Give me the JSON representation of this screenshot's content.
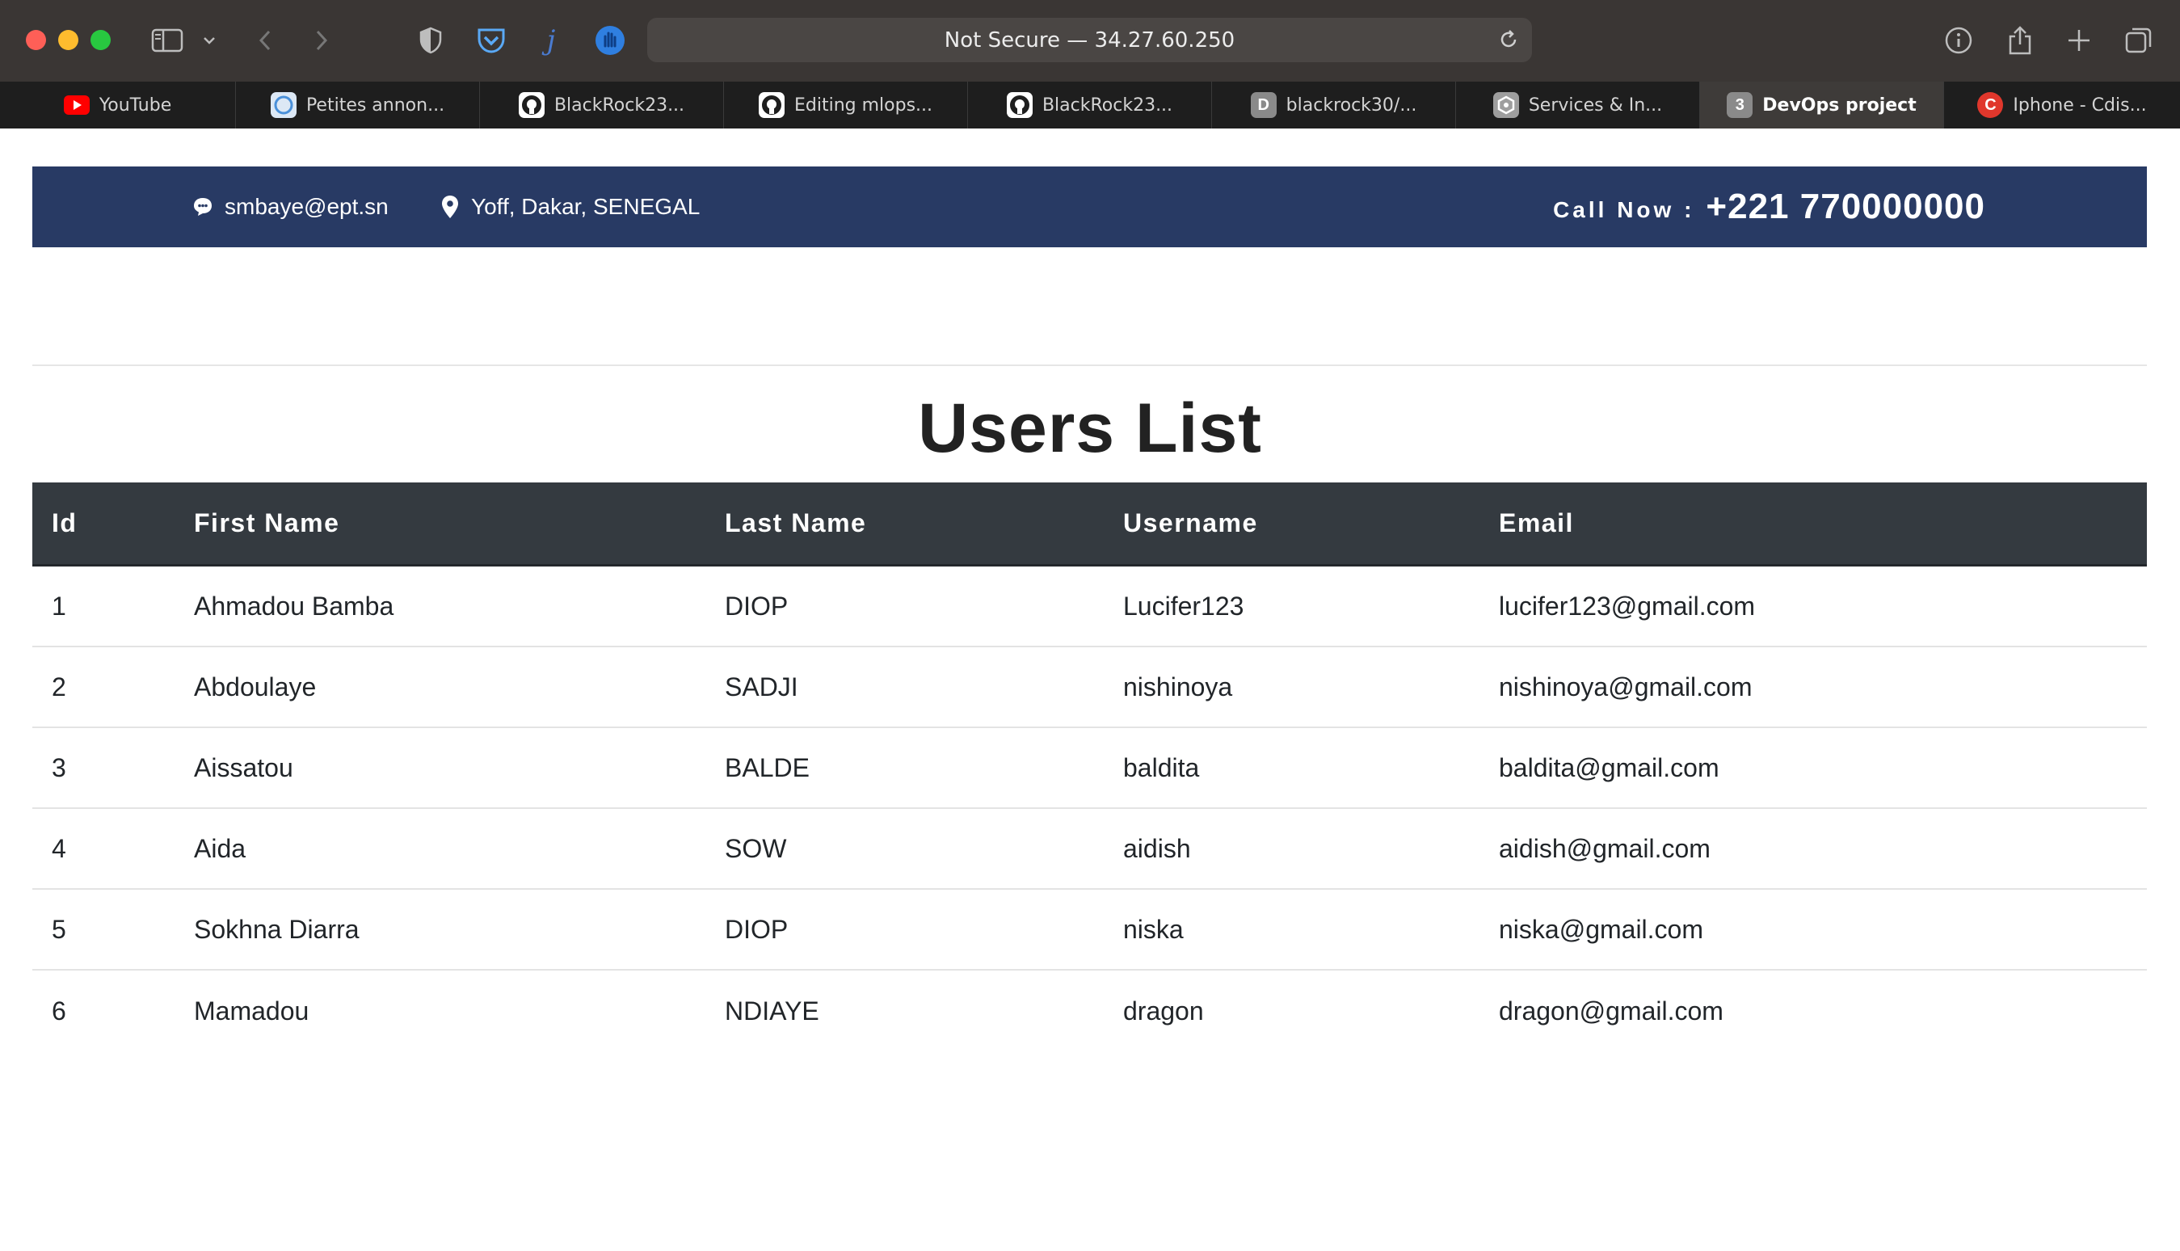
{
  "browser": {
    "address_text": "Not Secure — 34.27.60.250",
    "tabs": [
      {
        "label": "YouTube",
        "favicon": "youtube-icon",
        "color": "#ff0000"
      },
      {
        "label": "Petites annon...",
        "favicon": "petites-annonces-icon",
        "color": "#4a90d9"
      },
      {
        "label": "BlackRock23...",
        "favicon": "github-icon",
        "color": "#ffffff"
      },
      {
        "label": "Editing mlops...",
        "favicon": "github-icon",
        "color": "#ffffff"
      },
      {
        "label": "BlackRock23...",
        "favicon": "github-icon",
        "color": "#ffffff"
      },
      {
        "label": "blackrock30/...",
        "favicon": "d-letter-icon",
        "color": "#8a8a8a",
        "letter": "D"
      },
      {
        "label": "Services & In...",
        "favicon": "gcp-icon",
        "color": "#9e9e9e"
      },
      {
        "label": "DevOps project",
        "favicon": "number-3-icon",
        "color": "#8a8a8a",
        "letter": "3",
        "active": true
      },
      {
        "label": "Iphone - Cdis...",
        "favicon": "c-letter-icon",
        "color": "#e0372c",
        "letter": "C"
      }
    ]
  },
  "topbar": {
    "email": "smbaye@ept.sn",
    "location": "Yoff, Dakar, SENEGAL",
    "call_label": "Call Now :",
    "call_number": "+221 770000000",
    "bg_color": "#283a64"
  },
  "page": {
    "title": "Users List"
  },
  "table": {
    "headers": [
      "Id",
      "First Name",
      "Last Name",
      "Username",
      "Email"
    ],
    "rows": [
      [
        "1",
        "Ahmadou Bamba",
        "DIOP",
        "Lucifer123",
        "lucifer123@gmail.com"
      ],
      [
        "2",
        "Abdoulaye",
        "SADJI",
        "nishinoya",
        "nishinoya@gmail.com"
      ],
      [
        "3",
        "Aissatou",
        "BALDE",
        "baldita",
        "baldita@gmail.com"
      ],
      [
        "4",
        "Aida",
        "SOW",
        "aidish",
        "aidish@gmail.com"
      ],
      [
        "5",
        "Sokhna Diarra",
        "DIOP",
        "niska",
        "niska@gmail.com"
      ],
      [
        "6",
        "Mamadou",
        "NDIAYE",
        "dragon",
        "dragon@gmail.com"
      ]
    ]
  }
}
